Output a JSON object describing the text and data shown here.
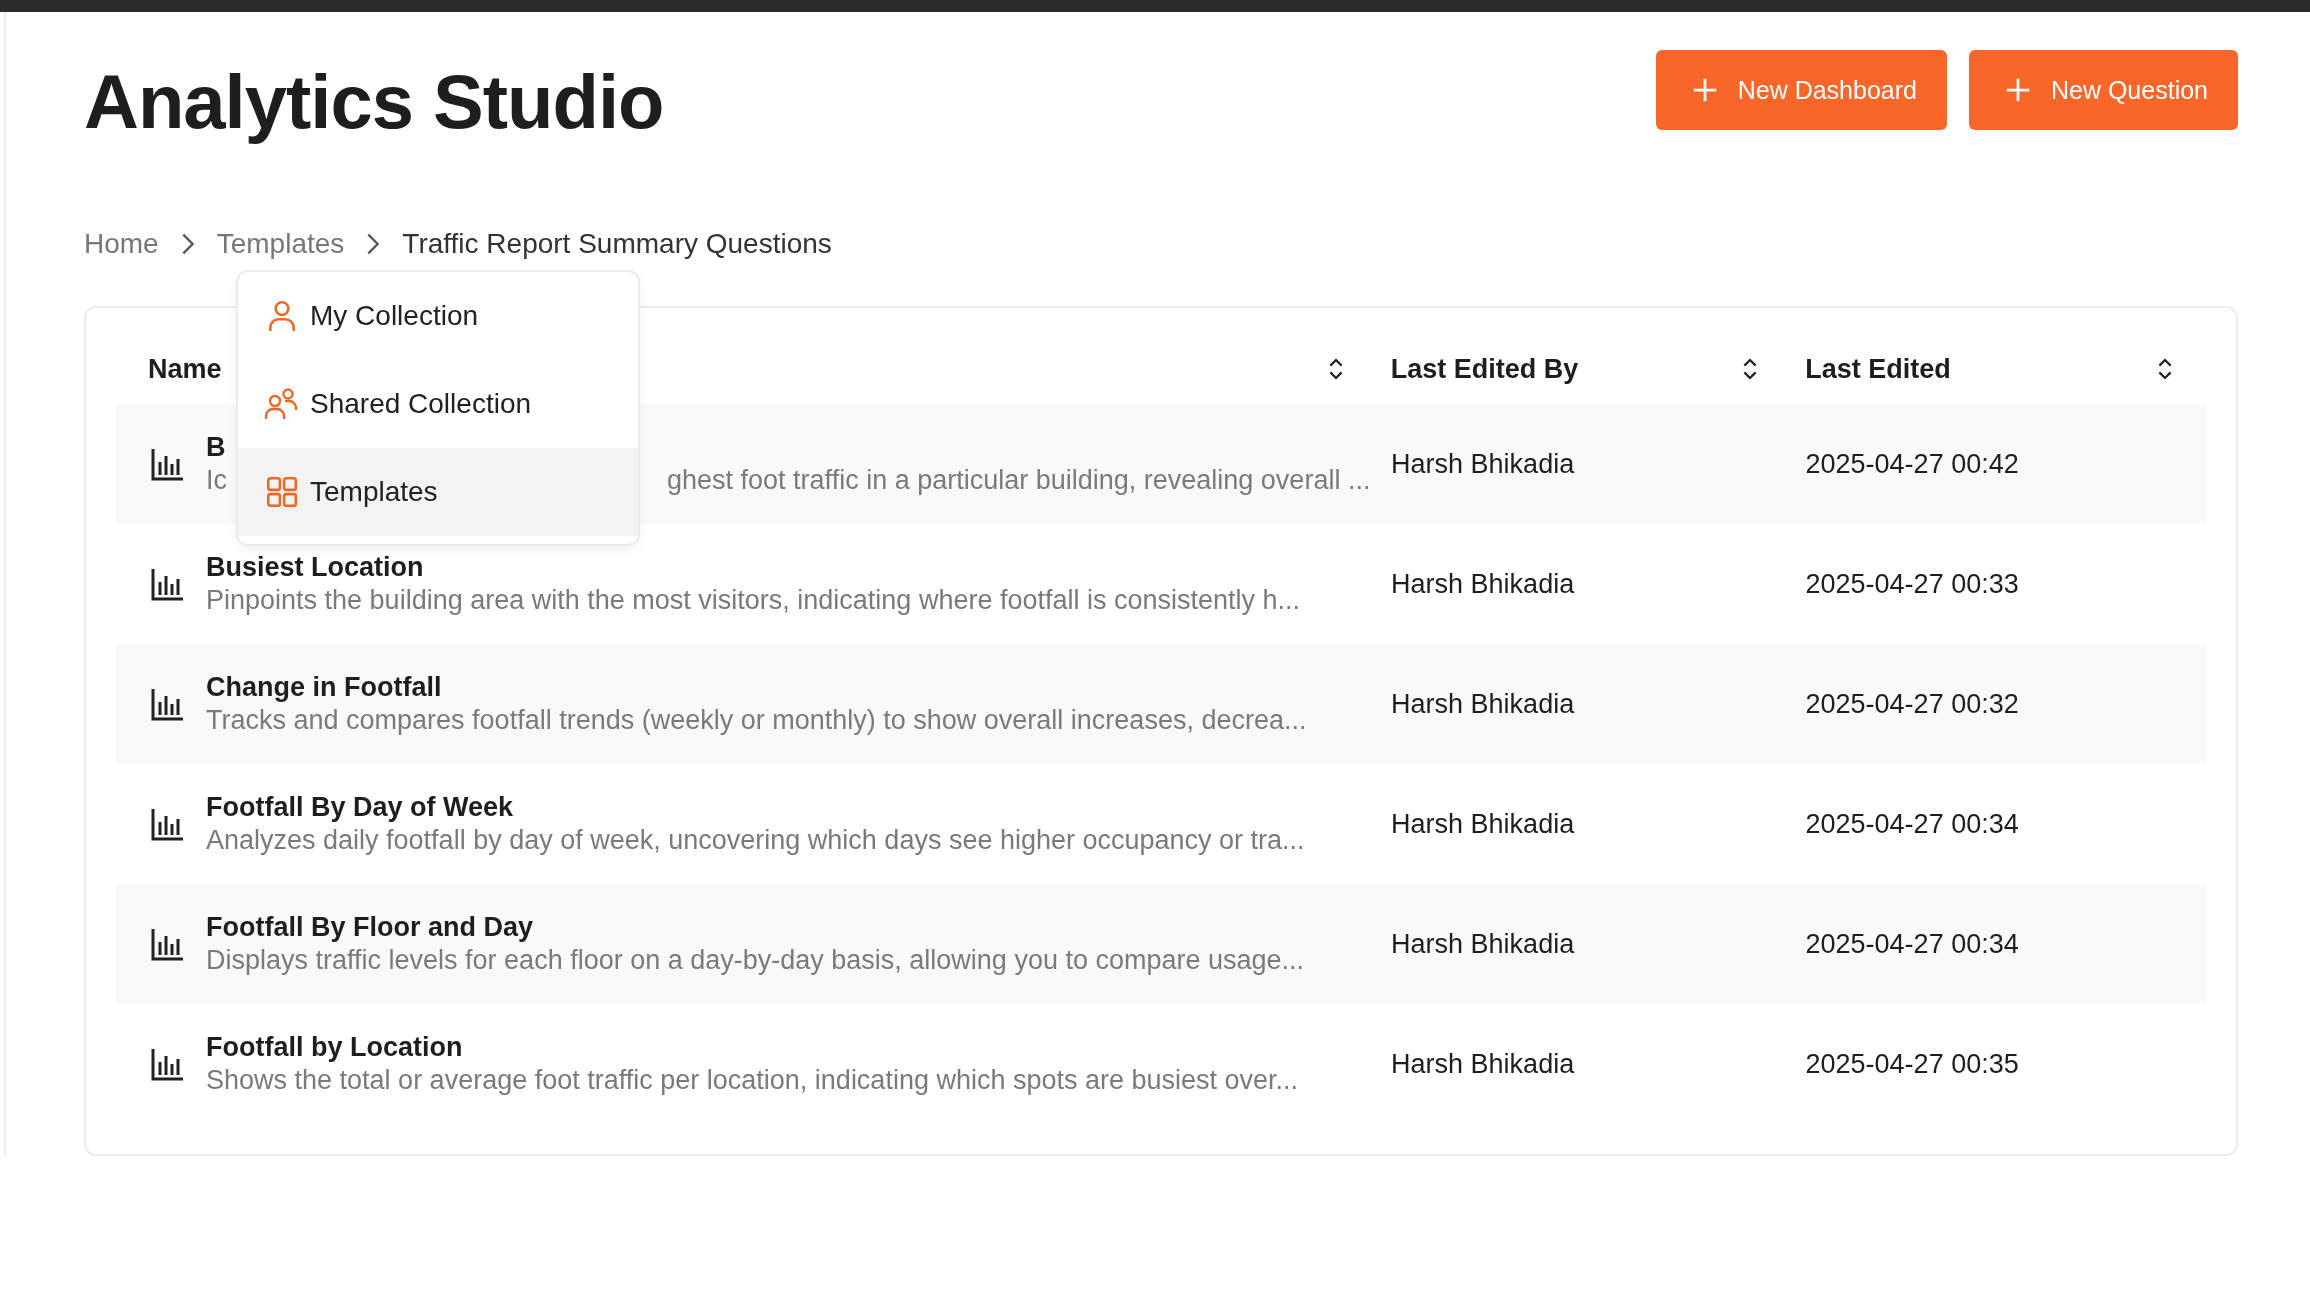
{
  "title": "Analytics Studio",
  "actions": [
    {
      "label": "New Dashboard"
    },
    {
      "label": "New Question"
    }
  ],
  "breadcrumb": [
    {
      "label": "Home",
      "current": false
    },
    {
      "label": "Templates",
      "current": false
    },
    {
      "label": "Traffic Report Summary Questions",
      "current": true
    }
  ],
  "collection_menu": {
    "items": [
      {
        "label": "My Collection",
        "kind": "person",
        "selected": false
      },
      {
        "label": "Shared Collection",
        "kind": "people",
        "selected": false
      },
      {
        "label": "Templates",
        "kind": "grid",
        "selected": true
      }
    ]
  },
  "table": {
    "columns": [
      {
        "label": "Name"
      },
      {
        "label": "Last Edited By"
      },
      {
        "label": "Last Edited"
      }
    ],
    "rows": [
      {
        "name": "B",
        "description_parts": [
          "Ic",
          "ghest foot traffic in a particular building, revealing overall ..."
        ],
        "editor": "Harsh Bhikadia",
        "edited": "2025-04-27 00:42"
      },
      {
        "name": "Busiest Location",
        "description_parts": [
          "Pinpoints the building area with the most visitors, indicating where footfall is consistently h..."
        ],
        "editor": "Harsh Bhikadia",
        "edited": "2025-04-27 00:33"
      },
      {
        "name": "Change in Footfall",
        "description_parts": [
          "Tracks and compares footfall trends (weekly or monthly) to show overall increases, decrea..."
        ],
        "editor": "Harsh Bhikadia",
        "edited": "2025-04-27 00:32"
      },
      {
        "name": "Footfall By Day of Week",
        "description_parts": [
          "Analyzes daily footfall by day of week, uncovering which days see higher occupancy or tra..."
        ],
        "editor": "Harsh Bhikadia",
        "edited": "2025-04-27 00:34"
      },
      {
        "name": "Footfall By Floor and Day",
        "description_parts": [
          "Displays traffic levels for each floor on a day-by-day basis, allowing you to compare usage..."
        ],
        "editor": "Harsh Bhikadia",
        "edited": "2025-04-27 00:34"
      },
      {
        "name": "Footfall by Location",
        "description_parts": [
          "Shows the total or average foot traffic per location, indicating which spots are busiest over..."
        ],
        "editor": "Harsh Bhikadia",
        "edited": "2025-04-27 00:35"
      }
    ]
  }
}
